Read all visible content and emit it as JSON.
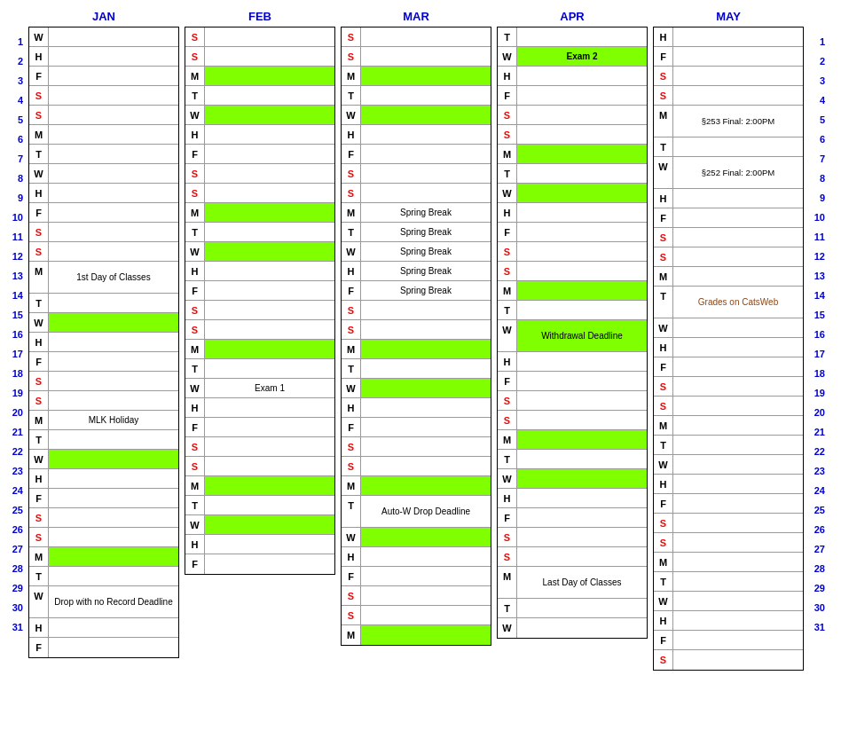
{
  "months": [
    "JAN",
    "FEB",
    "MAR",
    "APR",
    "MAY"
  ],
  "rowNumbers": [
    1,
    2,
    3,
    4,
    5,
    6,
    7,
    8,
    9,
    10,
    11,
    12,
    13,
    14,
    15,
    16,
    17,
    18,
    19,
    20,
    21,
    22,
    23,
    24,
    25,
    26,
    27,
    28,
    29,
    30,
    31
  ],
  "jan": [
    {
      "day": "W",
      "color": "black",
      "bg": "",
      "text": ""
    },
    {
      "day": "H",
      "color": "black",
      "bg": "",
      "text": ""
    },
    {
      "day": "F",
      "color": "black",
      "bg": "",
      "text": ""
    },
    {
      "day": "S",
      "color": "red",
      "bg": "",
      "text": ""
    },
    {
      "day": "S",
      "color": "red",
      "bg": "",
      "text": ""
    },
    {
      "day": "M",
      "color": "black",
      "bg": "",
      "text": ""
    },
    {
      "day": "T",
      "color": "black",
      "bg": "",
      "text": ""
    },
    {
      "day": "W",
      "color": "black",
      "bg": "",
      "text": ""
    },
    {
      "day": "H",
      "color": "black",
      "bg": "",
      "text": ""
    },
    {
      "day": "F",
      "color": "black",
      "bg": "",
      "text": ""
    },
    {
      "day": "S",
      "color": "red",
      "bg": "",
      "text": ""
    },
    {
      "day": "S",
      "color": "red",
      "bg": "",
      "text": ""
    },
    {
      "day": "M",
      "color": "black",
      "bg": "",
      "text": "1st Day of Classes"
    },
    {
      "day": "T",
      "color": "black",
      "bg": "",
      "text": ""
    },
    {
      "day": "W",
      "color": "black",
      "bg": "green",
      "text": ""
    },
    {
      "day": "H",
      "color": "black",
      "bg": "",
      "text": ""
    },
    {
      "day": "F",
      "color": "black",
      "bg": "",
      "text": ""
    },
    {
      "day": "S",
      "color": "red",
      "bg": "",
      "text": ""
    },
    {
      "day": "S",
      "color": "red",
      "bg": "",
      "text": ""
    },
    {
      "day": "M",
      "color": "black",
      "bg": "",
      "text": "MLK Holiday"
    },
    {
      "day": "T",
      "color": "black",
      "bg": "",
      "text": ""
    },
    {
      "day": "W",
      "color": "black",
      "bg": "green",
      "text": ""
    },
    {
      "day": "H",
      "color": "black",
      "bg": "",
      "text": ""
    },
    {
      "day": "F",
      "color": "black",
      "bg": "",
      "text": ""
    },
    {
      "day": "S",
      "color": "red",
      "bg": "",
      "text": ""
    },
    {
      "day": "S",
      "color": "red",
      "bg": "",
      "text": ""
    },
    {
      "day": "M",
      "color": "black",
      "bg": "green",
      "text": ""
    },
    {
      "day": "T",
      "color": "black",
      "bg": "",
      "text": ""
    },
    {
      "day": "W",
      "color": "black",
      "bg": "",
      "text": "Drop with no Record Deadline"
    },
    {
      "day": "H",
      "color": "black",
      "bg": "",
      "text": ""
    },
    {
      "day": "F",
      "color": "black",
      "bg": "",
      "text": ""
    }
  ],
  "feb": [
    {
      "day": "S",
      "color": "red",
      "bg": "",
      "text": ""
    },
    {
      "day": "S",
      "color": "red",
      "bg": "",
      "text": ""
    },
    {
      "day": "M",
      "color": "black",
      "bg": "green",
      "text": ""
    },
    {
      "day": "T",
      "color": "black",
      "bg": "",
      "text": ""
    },
    {
      "day": "W",
      "color": "black",
      "bg": "green",
      "text": ""
    },
    {
      "day": "H",
      "color": "black",
      "bg": "",
      "text": ""
    },
    {
      "day": "F",
      "color": "black",
      "bg": "",
      "text": ""
    },
    {
      "day": "S",
      "color": "red",
      "bg": "",
      "text": ""
    },
    {
      "day": "S",
      "color": "red",
      "bg": "",
      "text": ""
    },
    {
      "day": "M",
      "color": "black",
      "bg": "green",
      "text": ""
    },
    {
      "day": "T",
      "color": "black",
      "bg": "",
      "text": ""
    },
    {
      "day": "W",
      "color": "black",
      "bg": "green",
      "text": ""
    },
    {
      "day": "H",
      "color": "black",
      "bg": "",
      "text": ""
    },
    {
      "day": "F",
      "color": "black",
      "bg": "",
      "text": ""
    },
    {
      "day": "S",
      "color": "red",
      "bg": "",
      "text": ""
    },
    {
      "day": "S",
      "color": "red",
      "bg": "",
      "text": ""
    },
    {
      "day": "M",
      "color": "black",
      "bg": "green",
      "text": ""
    },
    {
      "day": "T",
      "color": "black",
      "bg": "",
      "text": ""
    },
    {
      "day": "W",
      "color": "black",
      "bg": "",
      "text": "Exam 1"
    },
    {
      "day": "H",
      "color": "black",
      "bg": "",
      "text": ""
    },
    {
      "day": "F",
      "color": "black",
      "bg": "",
      "text": ""
    },
    {
      "day": "S",
      "color": "red",
      "bg": "",
      "text": ""
    },
    {
      "day": "S",
      "color": "red",
      "bg": "",
      "text": ""
    },
    {
      "day": "M",
      "color": "black",
      "bg": "green",
      "text": ""
    },
    {
      "day": "T",
      "color": "black",
      "bg": "",
      "text": ""
    },
    {
      "day": "W",
      "color": "black",
      "bg": "green",
      "text": ""
    },
    {
      "day": "H",
      "color": "black",
      "bg": "",
      "text": ""
    },
    {
      "day": "F",
      "color": "black",
      "bg": "",
      "text": ""
    }
  ],
  "mar": [
    {
      "day": "S",
      "color": "red",
      "bg": "",
      "text": ""
    },
    {
      "day": "S",
      "color": "red",
      "bg": "",
      "text": ""
    },
    {
      "day": "M",
      "color": "black",
      "bg": "green",
      "text": ""
    },
    {
      "day": "T",
      "color": "black",
      "bg": "",
      "text": ""
    },
    {
      "day": "W",
      "color": "black",
      "bg": "green",
      "text": ""
    },
    {
      "day": "H",
      "color": "black",
      "bg": "",
      "text": ""
    },
    {
      "day": "F",
      "color": "black",
      "bg": "",
      "text": ""
    },
    {
      "day": "S",
      "color": "red",
      "bg": "",
      "text": ""
    },
    {
      "day": "S",
      "color": "red",
      "bg": "",
      "text": ""
    },
    {
      "day": "M",
      "color": "black",
      "bg": "",
      "text": "Spring Break"
    },
    {
      "day": "T",
      "color": "black",
      "bg": "",
      "text": "Spring Break"
    },
    {
      "day": "W",
      "color": "black",
      "bg": "",
      "text": "Spring Break"
    },
    {
      "day": "H",
      "color": "black",
      "bg": "",
      "text": "Spring Break"
    },
    {
      "day": "F",
      "color": "black",
      "bg": "",
      "text": "Spring Break"
    },
    {
      "day": "S",
      "color": "red",
      "bg": "",
      "text": ""
    },
    {
      "day": "S",
      "color": "red",
      "bg": "",
      "text": ""
    },
    {
      "day": "M",
      "color": "black",
      "bg": "green",
      "text": ""
    },
    {
      "day": "T",
      "color": "black",
      "bg": "",
      "text": ""
    },
    {
      "day": "W",
      "color": "black",
      "bg": "green",
      "text": ""
    },
    {
      "day": "H",
      "color": "black",
      "bg": "",
      "text": ""
    },
    {
      "day": "F",
      "color": "black",
      "bg": "",
      "text": ""
    },
    {
      "day": "S",
      "color": "red",
      "bg": "",
      "text": ""
    },
    {
      "day": "S",
      "color": "red",
      "bg": "",
      "text": ""
    },
    {
      "day": "M",
      "color": "black",
      "bg": "green",
      "text": ""
    },
    {
      "day": "T",
      "color": "black",
      "bg": "",
      "text": "Auto-W Drop Deadline"
    },
    {
      "day": "W",
      "color": "black",
      "bg": "green",
      "text": ""
    },
    {
      "day": "H",
      "color": "black",
      "bg": "",
      "text": ""
    },
    {
      "day": "F",
      "color": "black",
      "bg": "",
      "text": ""
    },
    {
      "day": "S",
      "color": "red",
      "bg": "",
      "text": ""
    },
    {
      "day": "S",
      "color": "red",
      "bg": "",
      "text": ""
    },
    {
      "day": "M",
      "color": "black",
      "bg": "green",
      "text": ""
    }
  ],
  "apr": [
    {
      "day": "T",
      "color": "black",
      "bg": "",
      "text": ""
    },
    {
      "day": "W",
      "color": "black",
      "bg": "",
      "text": "Exam 2"
    },
    {
      "day": "H",
      "color": "black",
      "bg": "",
      "text": ""
    },
    {
      "day": "F",
      "color": "black",
      "bg": "",
      "text": ""
    },
    {
      "day": "S",
      "color": "red",
      "bg": "",
      "text": ""
    },
    {
      "day": "S",
      "color": "red",
      "bg": "",
      "text": ""
    },
    {
      "day": "M",
      "color": "black",
      "bg": "green",
      "text": ""
    },
    {
      "day": "T",
      "color": "black",
      "bg": "",
      "text": ""
    },
    {
      "day": "W",
      "color": "black",
      "bg": "green",
      "text": ""
    },
    {
      "day": "H",
      "color": "black",
      "bg": "",
      "text": ""
    },
    {
      "day": "F",
      "color": "black",
      "bg": "",
      "text": ""
    },
    {
      "day": "S",
      "color": "red",
      "bg": "",
      "text": ""
    },
    {
      "day": "S",
      "color": "red",
      "bg": "",
      "text": ""
    },
    {
      "day": "M",
      "color": "black",
      "bg": "green",
      "text": ""
    },
    {
      "day": "T",
      "color": "black",
      "bg": "",
      "text": ""
    },
    {
      "day": "W",
      "color": "black",
      "bg": "green",
      "text": "Withdrawal Deadline"
    },
    {
      "day": "H",
      "color": "black",
      "bg": "",
      "text": ""
    },
    {
      "day": "F",
      "color": "black",
      "bg": "",
      "text": ""
    },
    {
      "day": "S",
      "color": "red",
      "bg": "",
      "text": ""
    },
    {
      "day": "S",
      "color": "red",
      "bg": "",
      "text": ""
    },
    {
      "day": "M",
      "color": "black",
      "bg": "green",
      "text": ""
    },
    {
      "day": "T",
      "color": "black",
      "bg": "",
      "text": ""
    },
    {
      "day": "W",
      "color": "black",
      "bg": "green",
      "text": ""
    },
    {
      "day": "H",
      "color": "black",
      "bg": "",
      "text": ""
    },
    {
      "day": "F",
      "color": "black",
      "bg": "",
      "text": ""
    },
    {
      "day": "S",
      "color": "red",
      "bg": "",
      "text": ""
    },
    {
      "day": "S",
      "color": "red",
      "bg": "",
      "text": ""
    },
    {
      "day": "M",
      "color": "black",
      "bg": "",
      "text": "Last Day of Classes"
    },
    {
      "day": "T",
      "color": "black",
      "bg": "",
      "text": ""
    },
    {
      "day": "W",
      "color": "black",
      "bg": "",
      "text": ""
    }
  ],
  "may": [
    {
      "day": "H",
      "color": "black",
      "bg": "",
      "text": ""
    },
    {
      "day": "F",
      "color": "black",
      "bg": "",
      "text": ""
    },
    {
      "day": "S",
      "color": "red",
      "bg": "",
      "text": ""
    },
    {
      "day": "S",
      "color": "red",
      "bg": "",
      "text": ""
    },
    {
      "day": "M",
      "color": "black",
      "bg": "",
      "text": "§253 Final: 2:00PM"
    },
    {
      "day": "T",
      "color": "black",
      "bg": "",
      "text": ""
    },
    {
      "day": "W",
      "color": "black",
      "bg": "",
      "text": "§252 Final: 2:00PM"
    },
    {
      "day": "H",
      "color": "black",
      "bg": "",
      "text": ""
    },
    {
      "day": "F",
      "color": "black",
      "bg": "",
      "text": ""
    },
    {
      "day": "S",
      "color": "red",
      "bg": "",
      "text": ""
    },
    {
      "day": "S",
      "color": "red",
      "bg": "",
      "text": ""
    },
    {
      "day": "M",
      "color": "black",
      "bg": "",
      "text": ""
    },
    {
      "day": "T",
      "color": "black",
      "bg": "",
      "text": "Grades on CatsWeb"
    },
    {
      "day": "W",
      "color": "black",
      "bg": "",
      "text": ""
    },
    {
      "day": "H",
      "color": "black",
      "bg": "",
      "text": ""
    },
    {
      "day": "F",
      "color": "black",
      "bg": "",
      "text": ""
    },
    {
      "day": "S",
      "color": "red",
      "bg": "",
      "text": ""
    },
    {
      "day": "S",
      "color": "red",
      "bg": "",
      "text": ""
    },
    {
      "day": "M",
      "color": "black",
      "bg": "",
      "text": ""
    },
    {
      "day": "T",
      "color": "black",
      "bg": "",
      "text": ""
    },
    {
      "day": "W",
      "color": "black",
      "bg": "",
      "text": ""
    },
    {
      "day": "H",
      "color": "black",
      "bg": "",
      "text": ""
    },
    {
      "day": "F",
      "color": "black",
      "bg": "",
      "text": ""
    },
    {
      "day": "S",
      "color": "red",
      "bg": "",
      "text": ""
    },
    {
      "day": "S",
      "color": "red",
      "bg": "",
      "text": ""
    },
    {
      "day": "M",
      "color": "black",
      "bg": "",
      "text": ""
    },
    {
      "day": "T",
      "color": "black",
      "bg": "",
      "text": ""
    },
    {
      "day": "W",
      "color": "black",
      "bg": "",
      "text": ""
    },
    {
      "day": "H",
      "color": "black",
      "bg": "",
      "text": ""
    },
    {
      "day": "F",
      "color": "black",
      "bg": "",
      "text": ""
    },
    {
      "day": "S",
      "color": "red",
      "bg": "",
      "text": ""
    }
  ]
}
